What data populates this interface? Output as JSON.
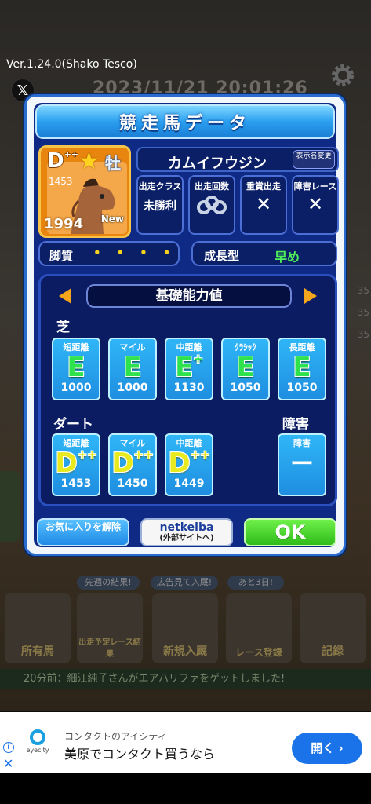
{
  "status": {
    "version": "Ver.1.24.0(Shako Tesco)",
    "bg_datetime": "2023/11/21 20:01:26"
  },
  "dialog": {
    "title": "競走馬データ",
    "horse": {
      "rank": "D",
      "rank_suffix": "++",
      "star": "★",
      "sex": "牡",
      "small_number": "1453",
      "year": "1994",
      "new_badge": "New",
      "name": "カムイフウジン"
    },
    "rename_button": "表示名変更",
    "stats": [
      {
        "label": "出走クラス",
        "value": "未勝利"
      },
      {
        "label": "出走回数",
        "value": ""
      },
      {
        "label": "重賞出走",
        "value": "✕"
      },
      {
        "label": "障害レース",
        "value": "✕"
      }
    ],
    "legs": {
      "label": "脚質",
      "dots": "••••"
    },
    "growth": {
      "label": "成長型",
      "value": "早め"
    },
    "ability": {
      "title": "基礎能力値",
      "turf_label": "芝",
      "turf": [
        {
          "label": "短距離",
          "grade": "E",
          "suffix": "",
          "value": "1000"
        },
        {
          "label": "マイル",
          "grade": "E",
          "suffix": "",
          "value": "1000"
        },
        {
          "label": "中距離",
          "grade": "E",
          "suffix": "+",
          "value": "1130"
        },
        {
          "label": "ｸﾗｼｯｸ",
          "grade": "E",
          "suffix": "",
          "value": "1050"
        },
        {
          "label": "長距離",
          "grade": "E",
          "suffix": "",
          "value": "1050"
        }
      ],
      "dirt_label": "ダート",
      "dirt": [
        {
          "label": "短距離",
          "grade": "D",
          "suffix": "++",
          "value": "1453"
        },
        {
          "label": "マイル",
          "grade": "D",
          "suffix": "++",
          "value": "1450"
        },
        {
          "label": "中距離",
          "grade": "D",
          "suffix": "++",
          "value": "1449"
        }
      ],
      "hurdle_label": "障害",
      "hurdle": {
        "label": "障害",
        "value": "ー"
      }
    },
    "buttons": {
      "favorite": "お気に入りを解除",
      "netkeiba_title": "netkeiba",
      "netkeiba_sub": "(外部サイトへ)",
      "ok": "OK"
    }
  },
  "background": {
    "ribbons": [
      "先週の結果!",
      "広告見て入厩!",
      "あと3日!"
    ],
    "cards": [
      "所有馬",
      "出走予定レース結果",
      "新規入厩",
      "レース登録",
      "記録"
    ],
    "news": "20分前：細江純子さんがエアハリファをゲットしました!"
  },
  "ad": {
    "brand": "eyecity",
    "small": "コンタクトのアイシティ",
    "main": "美原でコンタクト買うなら",
    "open": "開く",
    "close": "✕",
    "info": "i"
  },
  "colors": {
    "accent_blue": "#2a6bd0",
    "ok_green": "#2fbb1a",
    "grade_green": "#2ee24e",
    "grade_yellow": "#e8ea1e"
  }
}
